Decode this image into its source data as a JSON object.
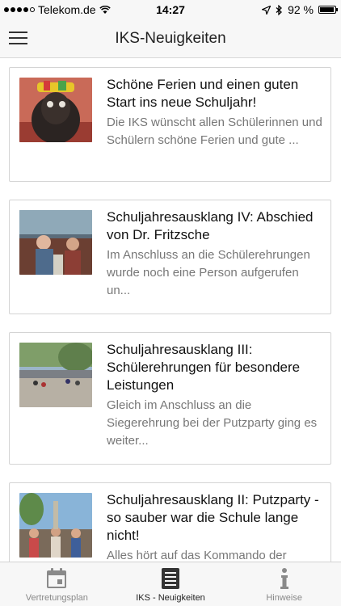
{
  "status": {
    "carrier": "Telekom.de",
    "time": "14:27",
    "battery": "92 %"
  },
  "nav": {
    "title": "IKS-Neuigkeiten"
  },
  "articles": [
    {
      "title": "Schöne Ferien und einen guten Start ins neue Schuljahr!",
      "excerpt": "Die IKS wünscht allen Schülerinnen und Schülern schöne Ferien und gute ..."
    },
    {
      "title": "Schuljahresausklang IV: Abschied von Dr. Fritzsche",
      "excerpt": "Im Anschluss an die Schülerehrungen wurde noch eine Person aufgerufen un..."
    },
    {
      "title": "Schuljahresausklang III: Schülerehrungen für besondere Leistungen",
      "excerpt": "Gleich im Anschluss an die Siegerehrung bei der Putzparty ging es weiter..."
    },
    {
      "title": "Schuljahresausklang II: Putzparty - so sauber war die Schule lange nicht!",
      "excerpt": "Alles hört auf das Kommando der"
    }
  ],
  "tabs": [
    {
      "label": "Vertretungsplan",
      "icon": "calendar-icon"
    },
    {
      "label": "IKS - Neuigkeiten",
      "icon": "news-icon"
    },
    {
      "label": "Hinweise",
      "icon": "info-icon"
    }
  ],
  "colors": {
    "bar_background": "#f7f7f7",
    "card_border": "#d4d4d4",
    "excerpt_text": "#777777",
    "inactive_tab": "#888888"
  }
}
